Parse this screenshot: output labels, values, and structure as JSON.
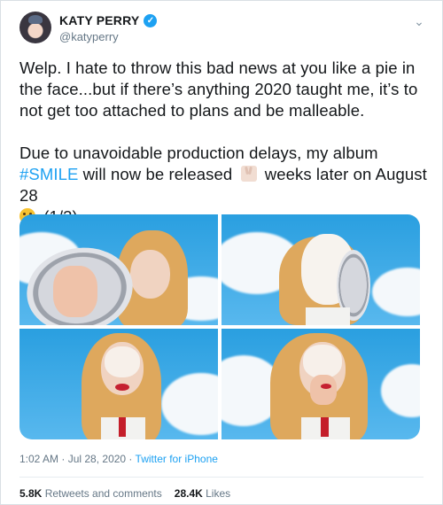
{
  "user": {
    "name": "KATY PERRY",
    "handle": "@katyperry",
    "verified_icon": "verified-badge-icon"
  },
  "tweet": {
    "para1": "Welp. I hate to throw this bad news at you like a pie in the face...but if there’s anything 2020 taught me, it’s to not get too attached to plans and be malleable.",
    "para2_before": "Due to unavoidable production delays, my album ",
    "hashtag": "#SMILE",
    "para2_mid": " will now be released ",
    "para2_after": " weeks later on August 28",
    "para2_end": " (1/3)"
  },
  "meta": {
    "time": "1:02 AM",
    "sep1": " · ",
    "date": "Jul 28, 2020",
    "sep2": " · ",
    "source": "Twitter for iPhone"
  },
  "stats": {
    "retweets_count": "5.8K",
    "retweets_label": " Retweets and comments",
    "likes_count": "28.4K",
    "likes_label": " Likes"
  },
  "colors": {
    "accent": "#1da1f2",
    "text": "#14171a",
    "muted": "#657786"
  }
}
